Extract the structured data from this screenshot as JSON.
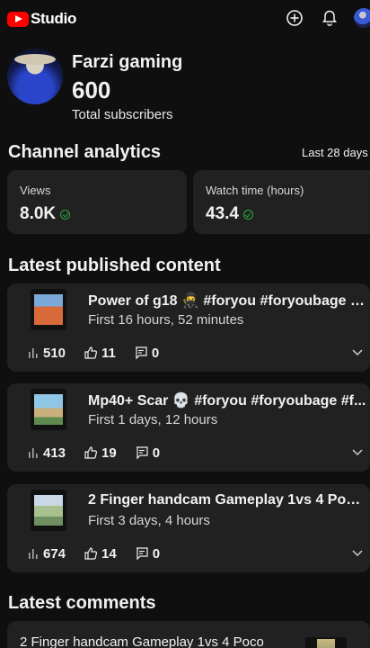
{
  "app": {
    "logo_text": "Studio"
  },
  "header_icons": [
    "create-icon",
    "bell-icon",
    "account-avatar"
  ],
  "channel": {
    "name": "Farzi gaming",
    "subscribers": "600",
    "subscribers_label": "Total subscribers"
  },
  "analytics": {
    "title": "Channel analytics",
    "period": "Last 28 days",
    "cards": [
      {
        "label": "Views",
        "value": "8.0K"
      },
      {
        "label": "Watch time (hours)",
        "value": "43.4"
      }
    ]
  },
  "latest": {
    "title": "Latest published content",
    "videos": [
      {
        "title": "Power of g18 🥷 #foryou #foryoubage #...",
        "age": "First 16 hours, 52 minutes",
        "views": "510",
        "likes": "11",
        "comments": "0"
      },
      {
        "title": "Mp40+ Scar 💀 #foryou #foryoubage #f...",
        "age": "First 1 days, 12 hours",
        "views": "413",
        "likes": "19",
        "comments": "0"
      },
      {
        "title": "2 Finger handcam Gameplay  1vs 4 Poco ...",
        "age": "First 3 days, 4 hours",
        "views": "674",
        "likes": "14",
        "comments": "0"
      }
    ]
  },
  "comments": {
    "title": "Latest comments",
    "first_comment_video": "2 Finger handcam Gameplay  1vs 4 Poco"
  },
  "colors": {
    "background": "#0f0f0f",
    "card": "#212121",
    "brand_red": "#ff0000",
    "check_green": "#2ba640"
  }
}
